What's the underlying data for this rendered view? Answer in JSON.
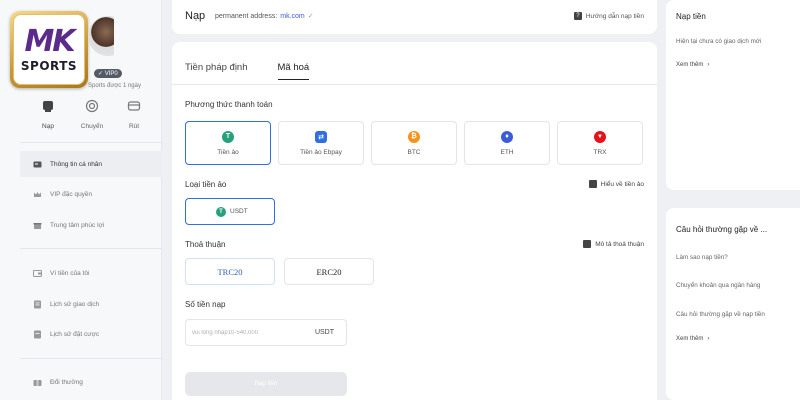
{
  "brand": {
    "logo_top": "MK",
    "logo_bottom": "SPORTS"
  },
  "user": {
    "vip": "VIP0",
    "subtitle": "Sports được 1 ngày"
  },
  "quick_actions": [
    {
      "label": "Nạp",
      "icon": "deposit-icon"
    },
    {
      "label": "Chuyển",
      "icon": "transfer-icon"
    },
    {
      "label": "Rút",
      "icon": "withdraw-icon"
    }
  ],
  "menu": {
    "group1": [
      {
        "label": "Thông tin cá nhân",
        "icon": "id-card-icon"
      },
      {
        "label": "VIP đặc quyền",
        "icon": "crown-icon"
      },
      {
        "label": "Trung tâm phúc lợi",
        "icon": "gift-icon"
      }
    ],
    "group2": [
      {
        "label": "Ví tiền của tôi",
        "icon": "wallet-icon"
      },
      {
        "label": "Lịch sử giao dịch",
        "icon": "history-icon"
      },
      {
        "label": "Lịch sử đặt cược",
        "icon": "bet-history-icon"
      }
    ],
    "group3": [
      {
        "label": "Đổi thưởng",
        "icon": "reward-icon"
      }
    ]
  },
  "header": {
    "title": "Nạp",
    "address_label": "permanent address:",
    "address_value": "mk.com",
    "guide": "Hướng dẫn nạp tiền"
  },
  "tabs": [
    {
      "label": "Tiền pháp định"
    },
    {
      "label": "Mã hoá"
    }
  ],
  "payment": {
    "label": "Phương thức thanh toán",
    "methods": [
      {
        "label": "Tiền ảo",
        "symbol": "T",
        "color": "#26a17b"
      },
      {
        "label": "Tiền ảo Ebpay",
        "symbol": "⇄",
        "color": "#2f6fe0"
      },
      {
        "label": "BTC",
        "symbol": "₿",
        "color": "#f7931a"
      },
      {
        "label": "ETH",
        "symbol": "♦",
        "color": "#3c5bd9"
      },
      {
        "label": "TRX",
        "symbol": "▼",
        "color": "#e5121b"
      }
    ]
  },
  "coin_type": {
    "label": "Loại tiền ảo",
    "help": "Hiểu về tiền ảo",
    "selected": "USDT"
  },
  "protocol": {
    "label": "Thoả thuận",
    "help": "Mô tả thoả thuận",
    "options": [
      "TRC20",
      "ERC20"
    ]
  },
  "amount": {
    "label": "Số tiền nạp",
    "placeholder": "vui lòng nhập10-540,000",
    "unit": "USDT"
  },
  "submit_label": "Nạp tiền",
  "right_panel": {
    "deposit_title": "Nạp tiền",
    "deposit_empty": "Hiện tại chưa có giao dịch mới",
    "more": "Xem thêm",
    "faq_title": "Câu hỏi thường gặp về ...",
    "faq": [
      "Làm sao nạp tiền?",
      "Chuyển khoản qua ngân hàng",
      "Câu hỏi thường gặp về nạp tiền"
    ],
    "faq_more": "Xem thêm"
  }
}
